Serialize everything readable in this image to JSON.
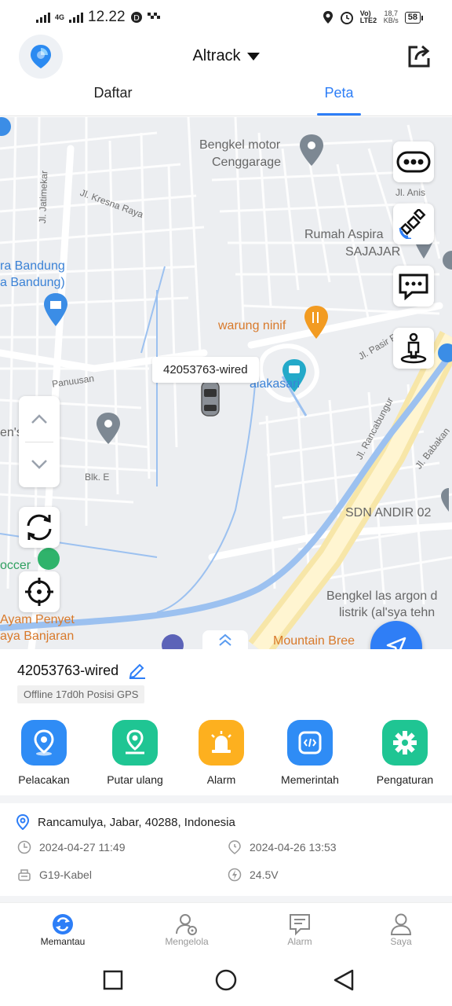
{
  "status_bar": {
    "time": "12.22",
    "network": "4G",
    "volte": "Vo) LTE2",
    "speed_value": "18,7",
    "speed_unit": "KB/s",
    "battery": "58"
  },
  "header": {
    "title": "Altrack",
    "logo_icon": "location-pie-icon",
    "share_icon": "export-icon"
  },
  "tabs": [
    {
      "label": "Daftar",
      "active": false
    },
    {
      "label": "Peta",
      "active": true
    }
  ],
  "map": {
    "labels": {
      "bengkel_motor_1": "Bengkel motor",
      "bengkel_motor_2": "Cenggarage",
      "jl_anis": "Jl. Anis",
      "jl_jatimekar": "Jl. Jatimekar",
      "jl_kresna": "Jl. Kresna Raya",
      "rumah_aspira_1": "Rumah Aspira",
      "rumah_aspira_2": "SAJAJAR",
      "bandung_1": "ra Bandung",
      "bandung_2": "a Bandung)",
      "warung": "warung ninif",
      "jl_pasir": "Jl. Pasir R",
      "panuusan": "Panuusan",
      "malakasari": "alakasari",
      "sport": "en's Sport",
      "blk_e": "Blk. E",
      "jl_rancabungur": "Jl. Rancabungur",
      "jl_babakan": "Jl. Babakan",
      "sdn": "SDN ANDIR 02",
      "bengkel_las_1": "Bengkel las argon d",
      "bengkel_las_2": "listrik (al'sya tehn",
      "soccer": "occer",
      "ayam_1": "Ayam Penyet",
      "ayam_2": "aya Banjaran",
      "mountain": "Mountain Bree"
    },
    "device_tag": "42053763-wired",
    "controls": [
      "more-icon",
      "satellite-icon",
      "message-icon",
      "street-view-icon"
    ]
  },
  "device": {
    "name": "42053763-wired",
    "status": "Offline 17d0h Posisi GPS"
  },
  "actions": [
    {
      "label": "Pelacakan",
      "icon": "location-pin-icon",
      "color": "#2f8cf5"
    },
    {
      "label": "Putar ulang",
      "icon": "replay-pin-icon",
      "color": "#1fc593"
    },
    {
      "label": "Alarm",
      "icon": "siren-icon",
      "color": "#fdb01f"
    },
    {
      "label": "Memerintah",
      "icon": "command-icon",
      "color": "#2f8cf5"
    },
    {
      "label": "Pengaturan",
      "icon": "gear-icon",
      "color": "#1fc593"
    }
  ],
  "info": {
    "address": "Rancamulya, Jabar, 40288, Indonesia",
    "last_comm": "2024-04-27 11:49",
    "last_position": "2024-04-26 13:53",
    "model": "G19-Kabel",
    "voltage": "24.5V"
  },
  "bottom_nav": [
    {
      "label": "Memantau",
      "active": true
    },
    {
      "label": "Mengelola",
      "active": false
    },
    {
      "label": "Alarm",
      "active": false
    },
    {
      "label": "Saya",
      "active": false
    }
  ]
}
